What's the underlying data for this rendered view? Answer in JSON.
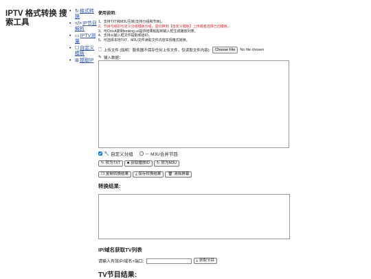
{
  "app": {
    "title": "IPTV 格式转换 搜索工具"
  },
  "nav": [
    {
      "icon": "↻",
      "label": "格式转换"
    },
    {
      "icon": "</>",
      "label": "IP节目解析"
    },
    {
      "icon": "▭",
      "label": "IPTV测量"
    },
    {
      "icon": "☐",
      "label": "自定义模板"
    },
    {
      "icon": "⊞",
      "label": "提取IP"
    }
  ],
  "usage": {
    "title": "使用说明:",
    "steps": [
      {
        "text": "1、支持TXT和M3U互转(支持分组和节目)。",
        "red": false
      },
      {
        "text": "2、节目与组别与定义分组模板分组，需切换到【自定义模板】上传或者选择已创模板。",
        "red": true
      },
      {
        "text": "3、可Ctrl+A复制tonking.us提供结果粘贴到输入框生成播放列表。",
        "red": false
      },
      {
        "text": "4、支持从输入框文件提取频道ID。",
        "red": false
      },
      {
        "text": "5、可选择本地TXT、M3U文件读取文件内容实现格式转换。",
        "red": false
      }
    ]
  },
  "upload": {
    "label": "上传文件 (說明：服务器不保存任何上传文件，仅读取文件内容):",
    "button": "Choose File",
    "status": "No file chosen"
  },
  "input": {
    "label": "输入数据："
  },
  "options": {
    "custom_group": "自定义分组",
    "m3u_merge": "M3U合并节目",
    "custom_checked": true,
    "m3u_checked": false
  },
  "buttons_row1": [
    {
      "icon": "↻",
      "label": "转为TXT"
    },
    {
      "icon": "■",
      "label": "获取播放ID"
    },
    {
      "icon": "↻",
      "label": "转为M3U"
    }
  ],
  "buttons_row2": [
    {
      "icon": "❐",
      "label": "复制转换结果"
    },
    {
      "icon": "⤓",
      "label": "保存转换结果"
    },
    {
      "icon": "🗑",
      "label": "清除屏幕"
    }
  ],
  "result": {
    "title": "转换结果:"
  },
  "ip_section": {
    "title": "IP/域名获取TV列表",
    "prompt": "请输入有效IP/域名+端口:",
    "button_icon": "⤓",
    "button": "获取节目"
  },
  "tv_result": {
    "title": "TV节目结果:"
  }
}
